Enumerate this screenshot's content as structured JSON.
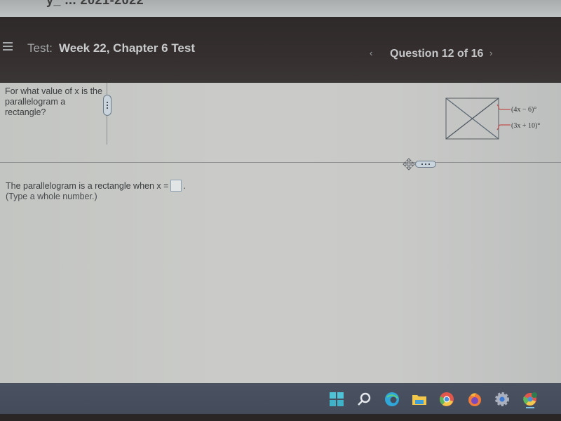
{
  "browser": {
    "cut_off_title": "y_ ... 2021-2022"
  },
  "header": {
    "menu_icon": "hamburger-menu-icon",
    "test_label": "Test:",
    "test_name": "Week 22, Chapter 6 Test",
    "prev_icon": "‹",
    "question_counter": "Question 12 of 16",
    "next_icon": "›"
  },
  "question": {
    "prompt": "For what value of x is the parallelogram a rectangle?",
    "figure": {
      "shape": "rectangle with diagonals",
      "angle_labels": [
        "(4x − 6)°",
        "(3x + 10)°"
      ],
      "label_color": "#c0504d"
    }
  },
  "answer": {
    "prefix": "The parallelogram is a rectangle when x =",
    "value": "",
    "suffix": ".",
    "hint": "(Type a whole number.)"
  },
  "taskbar": {
    "icons": [
      "windows-start-icon",
      "search-icon",
      "edge-icon",
      "file-explorer-icon",
      "chrome-icon",
      "firefox-icon",
      "settings-icon",
      "chrome-profile-icon"
    ]
  }
}
